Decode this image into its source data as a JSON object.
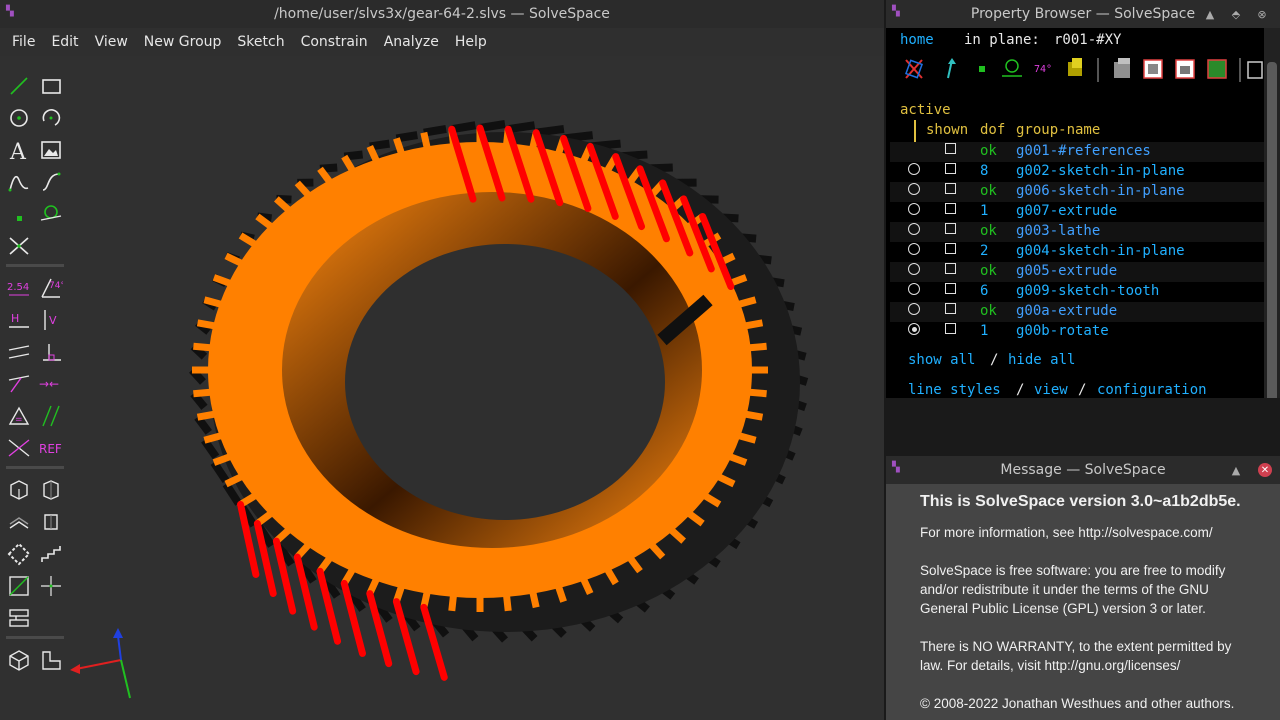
{
  "main_window": {
    "title": "/home/user/slvs3x/gear-64-2.slvs — SolveSpace",
    "menu": [
      "File",
      "Edit",
      "View",
      "New Group",
      "Sketch",
      "Constrain",
      "Analyze",
      "Help"
    ],
    "toolbar_icons": [
      "line-icon",
      "rectangle-icon",
      "circle-icon",
      "arc-icon",
      "text-icon",
      "image-icon",
      "bezier-icon",
      "spline-icon",
      "point-icon",
      "tangent-arc-icon",
      "split-curves-icon",
      "distance-constraint-icon",
      "angle-constraint-icon",
      "horizontal-icon",
      "vertical-icon",
      "parallel-icon",
      "perpendicular-icon",
      "on-entity-icon",
      "symmetric-icon",
      "equal-icon",
      "same-orientation-icon",
      "midpoint-icon",
      "reference-icon",
      "nearest-iso-icon",
      "nearest-ortho-icon",
      "toggle-hidden-icon",
      "toggle-outline-icon",
      "construction-icon",
      "step-icon",
      "workplane-icon",
      "ref-plane-icon",
      "trim-icon",
      "isometric-view-icon",
      "ortho-view-icon"
    ],
    "toolbar_labels": {
      "distance": "2.54",
      "angle": "74°",
      "ref": "REF"
    },
    "colors": {
      "gear": "#ff8000",
      "selected": "#ff0000",
      "axis_x": "#e02020",
      "axis_y": "#20c020",
      "axis_z": "#2040e0"
    }
  },
  "property_browser": {
    "title": "Property Browser — SolveSpace",
    "home": "home",
    "in_plane_label": "in plane:",
    "in_plane_value": "r001-#XY",
    "active_label": "active",
    "columns": {
      "shown": "shown",
      "dof": "dof",
      "name": "group-name"
    },
    "groups": [
      {
        "dof": "ok",
        "name": "g001-#references",
        "radio": false,
        "active": false
      },
      {
        "dof": "8",
        "name": "g002-sketch-in-plane",
        "radio": true,
        "active": false
      },
      {
        "dof": "ok",
        "name": "g006-sketch-in-plane",
        "radio": true,
        "active": false
      },
      {
        "dof": "1",
        "name": "g007-extrude",
        "radio": true,
        "active": false
      },
      {
        "dof": "ok",
        "name": "g003-lathe",
        "radio": true,
        "active": false
      },
      {
        "dof": "2",
        "name": "g004-sketch-in-plane",
        "radio": true,
        "active": false
      },
      {
        "dof": "ok",
        "name": "g005-extrude",
        "radio": true,
        "active": false
      },
      {
        "dof": "6",
        "name": "g009-sketch-tooth",
        "radio": true,
        "active": false
      },
      {
        "dof": "ok",
        "name": "g00a-extrude",
        "radio": true,
        "active": false
      },
      {
        "dof": "1",
        "name": "g00b-rotate",
        "radio": true,
        "active": true
      }
    ],
    "show_all": "show all",
    "slash": "/",
    "hide_all": "hide all",
    "line_styles": "line styles",
    "view": "view",
    "configuration": "configuration",
    "angle_icon_label": "74°"
  },
  "message_window": {
    "title": "Message — SolveSpace",
    "heading": "This is SolveSpace version 3.0~a1b2db5e.",
    "info": "For more information, see http://solvespace.com/",
    "license_1": "SolveSpace is free software: you are free to modify",
    "license_2": "and/or redistribute it under the terms of the GNU",
    "license_3": "General Public License (GPL) version 3 or later.",
    "warranty_1": "There is NO WARRANTY, to the extent permitted by",
    "warranty_2": "law. For details, visit http://gnu.org/licenses/",
    "copyright": "© 2008-2022 Jonathan Westhues and other authors."
  }
}
